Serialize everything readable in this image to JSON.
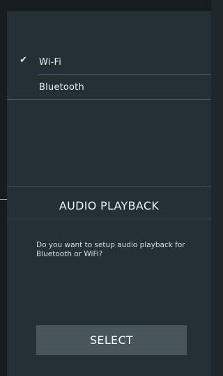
{
  "options": [
    {
      "label": "Wi-Fi",
      "checked": true
    },
    {
      "label": "Bluetooth",
      "checked": false
    }
  ],
  "checkmark": "✔",
  "dialog": {
    "title": "AUDIO PLAYBACK",
    "message": "Do you want to setup audio playback for Bluetooth or WiFi?",
    "select_label": "SELECT"
  },
  "colors": {
    "background": "#1f272b",
    "panel": "#243036",
    "button": "#48565c",
    "text": "#e9eef0"
  }
}
